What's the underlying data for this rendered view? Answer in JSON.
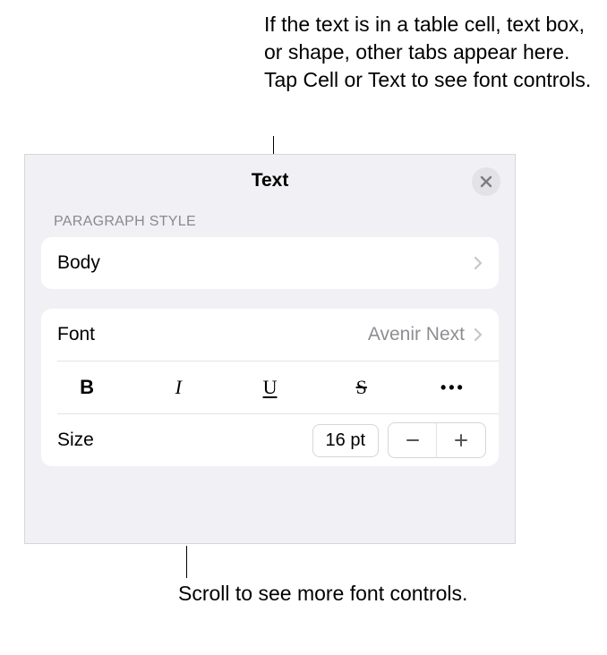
{
  "annotations": {
    "top": "If the text is in a table cell, text box, or shape, other tabs appear here. Tap Cell or Text to see font controls.",
    "bottom": "Scroll to see more font controls."
  },
  "panel": {
    "title": "Text",
    "paragraph_section_label": "PARAGRAPH STYLE",
    "paragraph_style": "Body",
    "font_label": "Font",
    "font_value": "Avenir Next",
    "size_label": "Size",
    "size_value": "16 pt",
    "style_buttons": {
      "bold": "B",
      "italic": "I",
      "underline": "U",
      "strike": "S",
      "more": "•••"
    }
  }
}
